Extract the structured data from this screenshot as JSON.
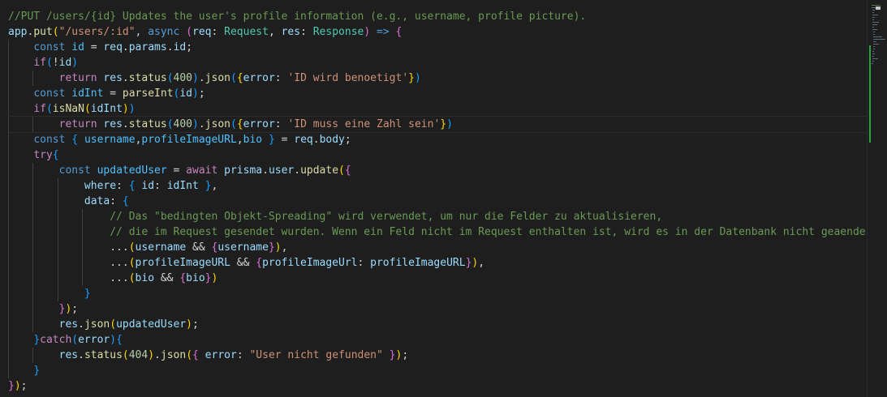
{
  "colors": {
    "background": "#1e1e1e",
    "comment": "#6a9955",
    "keyword": "#569cd6",
    "control": "#c586c0",
    "function": "#dcdcaa",
    "variable": "#9cdcfe",
    "constant": "#4fc1ff",
    "type": "#4ec9b0",
    "string": "#ce9178",
    "number": "#b5cea8",
    "bracket_gold": "#ffd700",
    "bracket_pink": "#da70d6",
    "bracket_blue": "#179fff",
    "plain": "#d4d4d4"
  },
  "editor": {
    "lines": [
      [
        [
          "c",
          "//PUT /users/{id} Updates the user's profile information (e.g., username, profile picture)."
        ]
      ],
      [
        [
          "v",
          "app"
        ],
        [
          "p",
          "."
        ],
        [
          "f",
          "put"
        ],
        [
          "g",
          "("
        ],
        [
          "s",
          "\"/users/:id\""
        ],
        [
          "p",
          ", "
        ],
        [
          "k",
          "async"
        ],
        [
          "p",
          " "
        ],
        [
          "m",
          "("
        ],
        [
          "v",
          "req"
        ],
        [
          "p",
          ": "
        ],
        [
          "t",
          "Request"
        ],
        [
          "p",
          ", "
        ],
        [
          "v",
          "res"
        ],
        [
          "p",
          ": "
        ],
        [
          "t",
          "Response"
        ],
        [
          "m",
          ")"
        ],
        [
          "p",
          " "
        ],
        [
          "k",
          "=>"
        ],
        [
          "p",
          " "
        ],
        [
          "m",
          "{"
        ]
      ],
      [
        [
          "p",
          "    "
        ],
        [
          "k",
          "const"
        ],
        [
          "p",
          " "
        ],
        [
          "n",
          "id"
        ],
        [
          "p",
          " = "
        ],
        [
          "v",
          "req"
        ],
        [
          "p",
          "."
        ],
        [
          "v",
          "params"
        ],
        [
          "p",
          "."
        ],
        [
          "v",
          "id"
        ],
        [
          "p",
          ";"
        ]
      ],
      [
        [
          "p",
          "    "
        ],
        [
          "x",
          "if"
        ],
        [
          "b",
          "("
        ],
        [
          "p",
          "!"
        ],
        [
          "v",
          "id"
        ],
        [
          "b",
          ")"
        ]
      ],
      [
        [
          "p",
          "        "
        ],
        [
          "x",
          "return"
        ],
        [
          "p",
          " "
        ],
        [
          "v",
          "res"
        ],
        [
          "p",
          "."
        ],
        [
          "f",
          "status"
        ],
        [
          "b",
          "("
        ],
        [
          "u",
          "400"
        ],
        [
          "b",
          ")"
        ],
        [
          "p",
          "."
        ],
        [
          "f",
          "json"
        ],
        [
          "b",
          "("
        ],
        [
          "g",
          "{"
        ],
        [
          "v",
          "error"
        ],
        [
          "p",
          ": "
        ],
        [
          "s",
          "'ID wird benoetigt'"
        ],
        [
          "g",
          "}"
        ],
        [
          "b",
          ")"
        ]
      ],
      [
        [
          "p",
          "    "
        ],
        [
          "k",
          "const"
        ],
        [
          "p",
          " "
        ],
        [
          "n",
          "idInt"
        ],
        [
          "p",
          " = "
        ],
        [
          "f",
          "parseInt"
        ],
        [
          "b",
          "("
        ],
        [
          "v",
          "id"
        ],
        [
          "b",
          ")"
        ],
        [
          "p",
          ";"
        ]
      ],
      [
        [
          "p",
          "    "
        ],
        [
          "x",
          "if"
        ],
        [
          "b",
          "("
        ],
        [
          "f",
          "isNaN"
        ],
        [
          "g",
          "("
        ],
        [
          "v",
          "idInt"
        ],
        [
          "g",
          ")"
        ],
        [
          "b",
          ")"
        ]
      ],
      [
        [
          "p",
          "        "
        ],
        [
          "x",
          "return"
        ],
        [
          "p",
          " "
        ],
        [
          "v",
          "res"
        ],
        [
          "p",
          "."
        ],
        [
          "f",
          "status"
        ],
        [
          "b",
          "("
        ],
        [
          "u",
          "400"
        ],
        [
          "b",
          ")"
        ],
        [
          "p",
          "."
        ],
        [
          "f",
          "json"
        ],
        [
          "b",
          "("
        ],
        [
          "g",
          "{"
        ],
        [
          "v",
          "error"
        ],
        [
          "p",
          ": "
        ],
        [
          "s",
          "'ID muss eine Zahl sein'"
        ],
        [
          "g",
          "}"
        ],
        [
          "b",
          ")"
        ]
      ],
      [
        [
          "p",
          "    "
        ],
        [
          "k",
          "const"
        ],
        [
          "p",
          " "
        ],
        [
          "b",
          "{"
        ],
        [
          "p",
          " "
        ],
        [
          "n",
          "username"
        ],
        [
          "p",
          ","
        ],
        [
          "n",
          "profileImageURL"
        ],
        [
          "p",
          ","
        ],
        [
          "n",
          "bio"
        ],
        [
          "p",
          " "
        ],
        [
          "b",
          "}"
        ],
        [
          "p",
          " = "
        ],
        [
          "v",
          "req"
        ],
        [
          "p",
          "."
        ],
        [
          "v",
          "body"
        ],
        [
          "p",
          ";"
        ]
      ],
      [
        [
          "p",
          "    "
        ],
        [
          "x",
          "try"
        ],
        [
          "b",
          "{"
        ]
      ],
      [
        [
          "p",
          "        "
        ],
        [
          "k",
          "const"
        ],
        [
          "p",
          " "
        ],
        [
          "n",
          "updatedUser"
        ],
        [
          "p",
          " = "
        ],
        [
          "x",
          "await"
        ],
        [
          "p",
          " "
        ],
        [
          "v",
          "prisma"
        ],
        [
          "p",
          "."
        ],
        [
          "v",
          "user"
        ],
        [
          "p",
          "."
        ],
        [
          "f",
          "update"
        ],
        [
          "g",
          "("
        ],
        [
          "m",
          "{"
        ]
      ],
      [
        [
          "p",
          "            "
        ],
        [
          "v",
          "where"
        ],
        [
          "p",
          ": "
        ],
        [
          "b",
          "{"
        ],
        [
          "p",
          " "
        ],
        [
          "v",
          "id"
        ],
        [
          "p",
          ": "
        ],
        [
          "v",
          "idInt"
        ],
        [
          "p",
          " "
        ],
        [
          "b",
          "}"
        ],
        [
          "p",
          ","
        ]
      ],
      [
        [
          "p",
          "            "
        ],
        [
          "v",
          "data"
        ],
        [
          "p",
          ": "
        ],
        [
          "b",
          "{"
        ]
      ],
      [
        [
          "p",
          "                "
        ],
        [
          "c",
          "// Das \"bedingten Objekt-Spreading\" wird verwendet, um nur die Felder zu aktualisieren,"
        ]
      ],
      [
        [
          "p",
          "                "
        ],
        [
          "c",
          "// die im Request gesendet wurden. Wenn ein Feld nicht im Request enthalten ist, wird es in der Datenbank nicht geaendert."
        ]
      ],
      [
        [
          "p",
          "                ..."
        ],
        [
          "g",
          "("
        ],
        [
          "v",
          "username"
        ],
        [
          "p",
          " && "
        ],
        [
          "m",
          "{"
        ],
        [
          "v",
          "username"
        ],
        [
          "m",
          "}"
        ],
        [
          "g",
          ")"
        ],
        [
          "p",
          ","
        ]
      ],
      [
        [
          "p",
          "                ..."
        ],
        [
          "g",
          "("
        ],
        [
          "v",
          "profileImageURL"
        ],
        [
          "p",
          " && "
        ],
        [
          "m",
          "{"
        ],
        [
          "v",
          "profileImageUrl"
        ],
        [
          "p",
          ": "
        ],
        [
          "v",
          "profileImageURL"
        ],
        [
          "m",
          "}"
        ],
        [
          "g",
          ")"
        ],
        [
          "p",
          ","
        ]
      ],
      [
        [
          "p",
          "                ..."
        ],
        [
          "g",
          "("
        ],
        [
          "v",
          "bio"
        ],
        [
          "p",
          " && "
        ],
        [
          "m",
          "{"
        ],
        [
          "v",
          "bio"
        ],
        [
          "m",
          "}"
        ],
        [
          "g",
          ")"
        ]
      ],
      [
        [
          "p",
          "            "
        ],
        [
          "b",
          "}"
        ]
      ],
      [
        [
          "p",
          "        "
        ],
        [
          "m",
          "}"
        ],
        [
          "g",
          ")"
        ],
        [
          "p",
          ";"
        ]
      ],
      [
        [
          "p",
          "        "
        ],
        [
          "v",
          "res"
        ],
        [
          "p",
          "."
        ],
        [
          "f",
          "json"
        ],
        [
          "g",
          "("
        ],
        [
          "v",
          "updatedUser"
        ],
        [
          "g",
          ")"
        ],
        [
          "p",
          ";"
        ]
      ],
      [
        [
          "p",
          "    "
        ],
        [
          "b",
          "}"
        ],
        [
          "x",
          "catch"
        ],
        [
          "b",
          "("
        ],
        [
          "v",
          "error"
        ],
        [
          "b",
          ")"
        ],
        [
          "b",
          "{"
        ]
      ],
      [
        [
          "p",
          "        "
        ],
        [
          "v",
          "res"
        ],
        [
          "p",
          "."
        ],
        [
          "f",
          "status"
        ],
        [
          "g",
          "("
        ],
        [
          "u",
          "404"
        ],
        [
          "g",
          ")"
        ],
        [
          "p",
          "."
        ],
        [
          "f",
          "json"
        ],
        [
          "g",
          "("
        ],
        [
          "m",
          "{"
        ],
        [
          "p",
          " "
        ],
        [
          "v",
          "error"
        ],
        [
          "p",
          ": "
        ],
        [
          "s",
          "\"User nicht gefunden\""
        ],
        [
          "p",
          " "
        ],
        [
          "m",
          "}"
        ],
        [
          "g",
          ")"
        ],
        [
          "p",
          ";"
        ]
      ],
      [
        [
          "p",
          "    "
        ],
        [
          "b",
          "}"
        ]
      ],
      [
        [
          "m",
          "}"
        ],
        [
          "g",
          ")"
        ],
        [
          "p",
          ";"
        ]
      ]
    ]
  }
}
